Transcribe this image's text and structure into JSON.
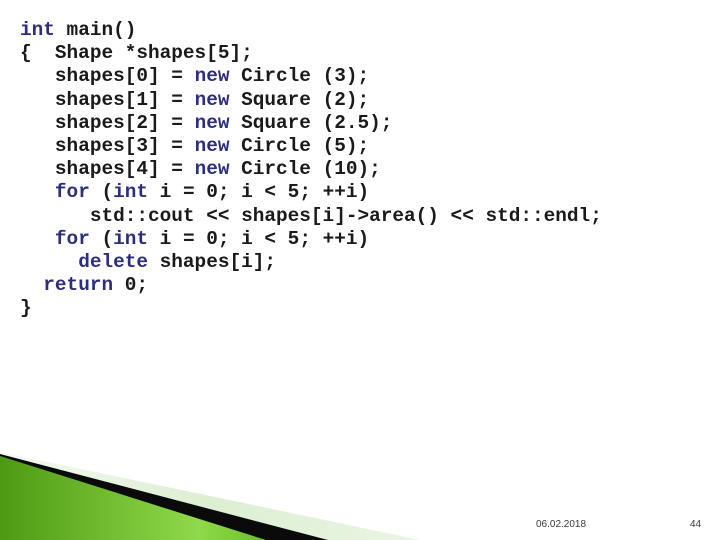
{
  "slide": {
    "code": {
      "language": "cpp",
      "colors": {
        "keyword": "#2e2e7e",
        "plain": "#1a1a1a"
      },
      "lines": [
        {
          "indent": 0,
          "tokens": [
            {
              "t": "int",
              "k": "kw"
            },
            {
              "t": " main()",
              "k": "plain"
            }
          ]
        },
        {
          "indent": 0,
          "tokens": [
            {
              "t": "{  Shape *shapes[5];",
              "k": "plain"
            }
          ]
        },
        {
          "indent": 3,
          "tokens": [
            {
              "t": "shapes[0] = ",
              "k": "plain"
            },
            {
              "t": "new",
              "k": "kw"
            },
            {
              "t": " Circle (3);",
              "k": "plain"
            }
          ]
        },
        {
          "indent": 3,
          "tokens": [
            {
              "t": "shapes[1] = ",
              "k": "plain"
            },
            {
              "t": "new",
              "k": "kw"
            },
            {
              "t": " Square (2);",
              "k": "plain"
            }
          ]
        },
        {
          "indent": 3,
          "tokens": [
            {
              "t": "shapes[2] = ",
              "k": "plain"
            },
            {
              "t": "new",
              "k": "kw"
            },
            {
              "t": " Square (2.5);",
              "k": "plain"
            }
          ]
        },
        {
          "indent": 3,
          "tokens": [
            {
              "t": "shapes[3] = ",
              "k": "plain"
            },
            {
              "t": "new",
              "k": "kw"
            },
            {
              "t": " Circle (5);",
              "k": "plain"
            }
          ]
        },
        {
          "indent": 3,
          "tokens": [
            {
              "t": "shapes[4] = ",
              "k": "plain"
            },
            {
              "t": "new",
              "k": "kw"
            },
            {
              "t": " Circle (10);",
              "k": "plain"
            }
          ]
        },
        {
          "indent": 3,
          "tokens": [
            {
              "t": "for",
              "k": "kw"
            },
            {
              "t": " (",
              "k": "plain"
            },
            {
              "t": "int",
              "k": "kw"
            },
            {
              "t": " i = 0; i < 5; ++i)",
              "k": "plain"
            }
          ]
        },
        {
          "indent": 6,
          "tokens": [
            {
              "t": "std::cout << shapes[i]->area() << std::endl;",
              "k": "plain"
            }
          ]
        },
        {
          "indent": 3,
          "tokens": [
            {
              "t": "for",
              "k": "kw"
            },
            {
              "t": " (",
              "k": "plain"
            },
            {
              "t": "int",
              "k": "kw"
            },
            {
              "t": " i = 0; i < 5; ++i)",
              "k": "plain"
            }
          ]
        },
        {
          "indent": 5,
          "tokens": [
            {
              "t": "delete",
              "k": "kw"
            },
            {
              "t": " shapes[i];",
              "k": "plain"
            }
          ]
        },
        {
          "indent": 2,
          "tokens": [
            {
              "t": "return",
              "k": "kw"
            },
            {
              "t": " 0;",
              "k": "plain"
            }
          ]
        },
        {
          "indent": 0,
          "tokens": [
            {
              "t": "}",
              "k": "plain"
            }
          ]
        }
      ]
    },
    "decoration": {
      "colors": {
        "green_light": "#8fd94a",
        "green_dark": "#4e9a12",
        "band_dark": "#0a0a0a",
        "band_pale": "#dcefd2"
      }
    },
    "footer": {
      "date": "06.02.2018",
      "page_number": "44"
    }
  }
}
